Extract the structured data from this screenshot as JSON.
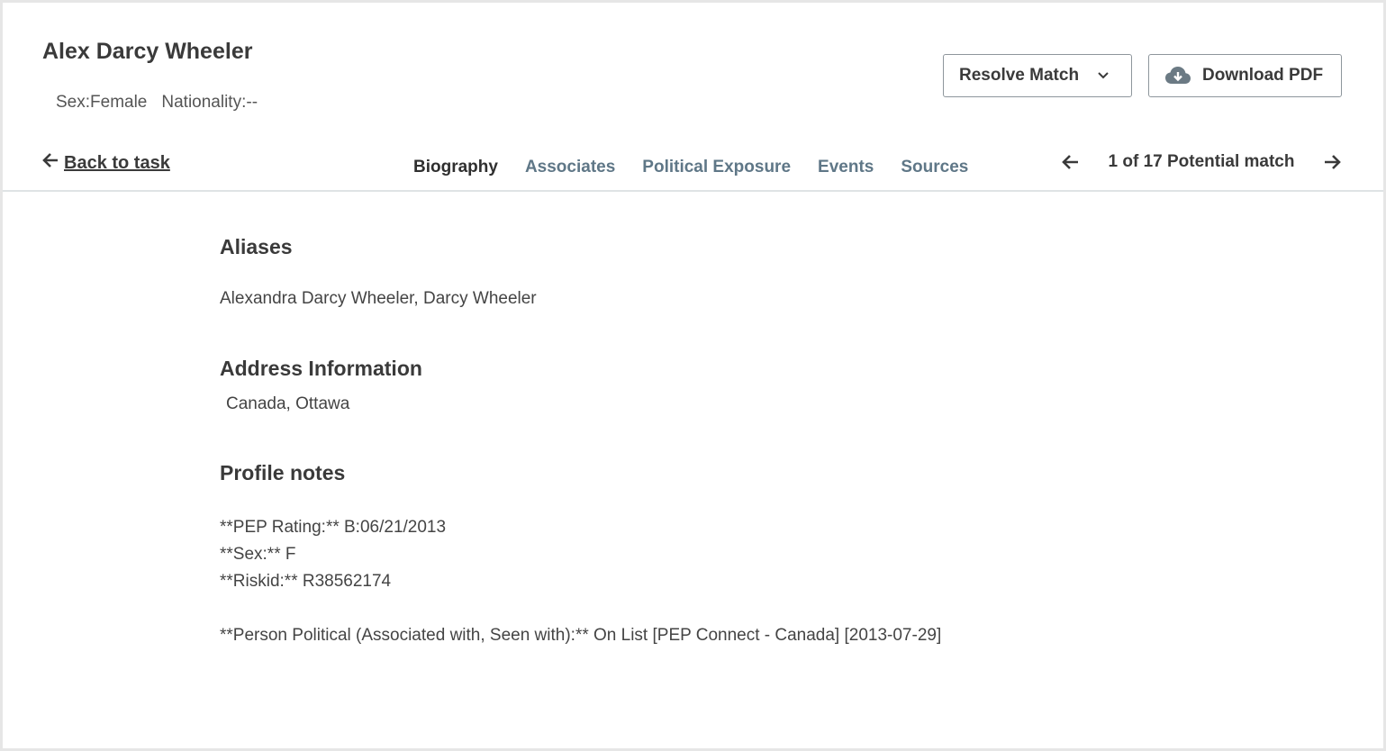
{
  "profile": {
    "name": "Alex Darcy Wheeler",
    "sex_label": "Sex:Female",
    "nationality_label": "Nationality:--"
  },
  "actions": {
    "resolve_label": "Resolve Match",
    "download_label": "Download PDF"
  },
  "nav": {
    "back_label": "Back to task",
    "tabs": [
      {
        "label": "Biography",
        "active": true
      },
      {
        "label": "Associates",
        "active": false
      },
      {
        "label": "Political Exposure",
        "active": false
      },
      {
        "label": "Events",
        "active": false
      },
      {
        "label": "Sources",
        "active": false
      }
    ],
    "pager_text": "1 of 17 Potential match"
  },
  "biography": {
    "aliases_title": "Aliases",
    "aliases_text": "Alexandra Darcy Wheeler, Darcy Wheeler",
    "address_title": "Address Information",
    "address_text": "Canada, Ottawa",
    "notes_title": "Profile notes",
    "notes_lines": [
      "**PEP Rating:** B:06/21/2013",
      "**Sex:** F",
      "**Riskid:** R38562174",
      "",
      "**Person Political (Associated with, Seen with):** On List [PEP Connect - Canada] [2013-07-29]"
    ]
  },
  "icons": {
    "back": "arrow-left-icon",
    "resolve_dropdown": "chevron-down-icon",
    "download": "cloud-download-icon",
    "pager_prev": "arrow-left-icon",
    "pager_next": "arrow-right-icon"
  },
  "colors": {
    "tab_inactive": "#5f7787",
    "tab_active": "#2f2f2f",
    "text": "#3a3a3a",
    "button_border": "#8e969c",
    "cloud_icon": "#6b7a84"
  }
}
